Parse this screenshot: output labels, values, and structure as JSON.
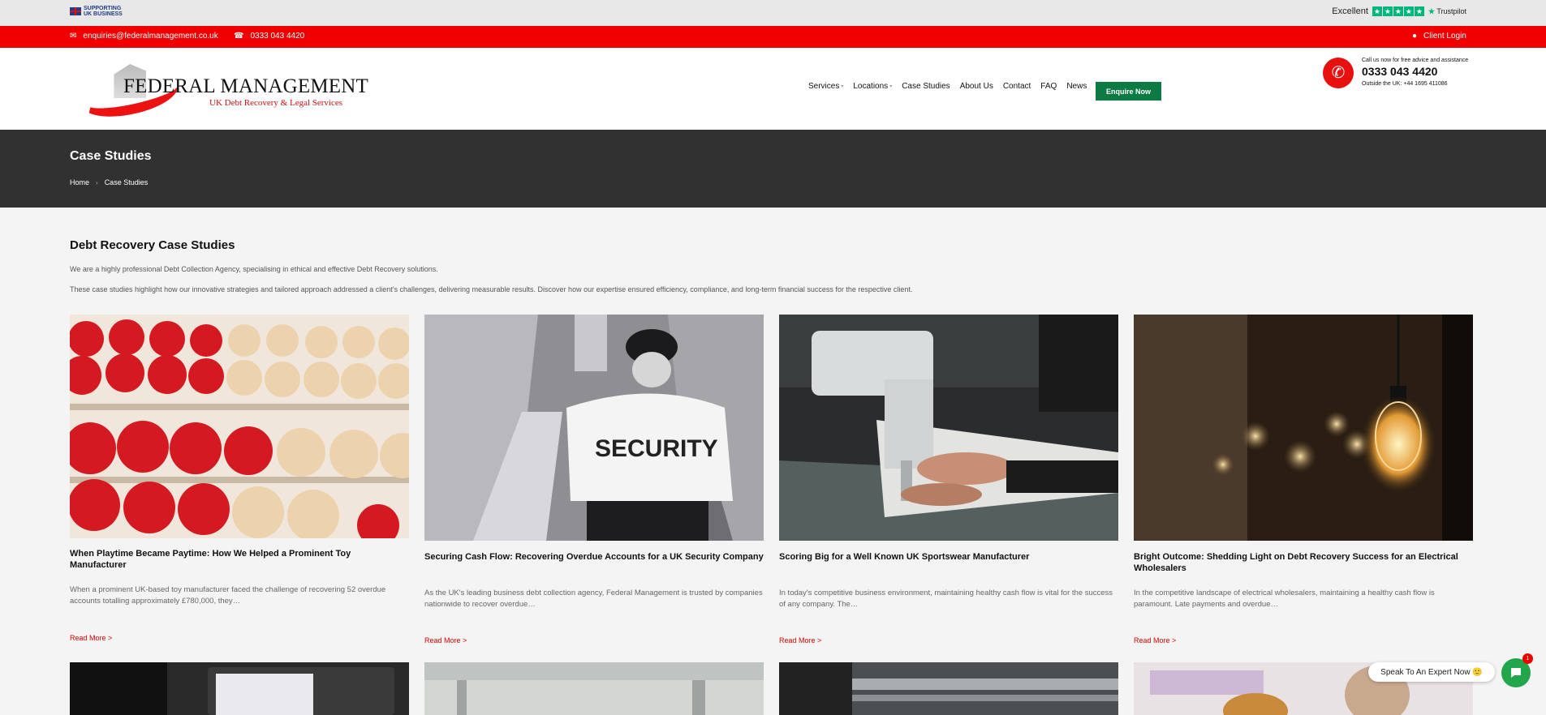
{
  "topbar": {
    "badge_line1": "SUPPORTING",
    "badge_line2": "UK BUSINESS",
    "trustpilot_rating": "Excellent",
    "trustpilot_brand": "Trustpilot",
    "stars": 5
  },
  "contact_bar": {
    "email": "enquiries@federalmanagement.co.uk",
    "phone": "0333 043 4420",
    "client_login": "Client Login"
  },
  "logo": {
    "name": "FEDERAL MANAGEMENT",
    "tagline": "UK Debt Recovery & Legal Services"
  },
  "nav": {
    "items": [
      {
        "label": "Services",
        "dropdown": true
      },
      {
        "label": "Locations",
        "dropdown": true
      },
      {
        "label": "Case Studies",
        "dropdown": false
      },
      {
        "label": "About Us",
        "dropdown": false
      },
      {
        "label": "Contact",
        "dropdown": false
      },
      {
        "label": "FAQ",
        "dropdown": false
      },
      {
        "label": "News",
        "dropdown": false
      }
    ],
    "cta": "Enquire Now"
  },
  "call": {
    "small": "Call us now for free advice and assistance",
    "number": "0333 043 4420",
    "outside": "Outside the UK: +44 1695 411086"
  },
  "page": {
    "title": "Case Studies",
    "breadcrumb": [
      "Home",
      "Case Studies"
    ]
  },
  "intro": {
    "heading": "Debt Recovery Case Studies",
    "p1": "We are a highly professional Debt Collection Agency, specialising in ethical and effective Debt Recovery solutions.",
    "p2": "These case studies highlight how our innovative strategies and tailored approach addressed a client's challenges, delivering measurable results. Discover how our expertise ensured efficiency, compliance, and long-term financial success for the respective client."
  },
  "cards": [
    {
      "title": "When Playtime Became Paytime: How We Helped a Prominent Toy Manufacturer",
      "excerpt": "When a prominent UK-based toy manufacturer faced the challenge of recovering 52 overdue accounts totalling approximately £780,000, they…",
      "read_more": "Read More >",
      "image": "abacus-photo"
    },
    {
      "title": "Securing Cash Flow: Recovering Overdue Accounts for a UK Security Company",
      "excerpt": "As the UK's leading business debt collection agency, Federal Management is trusted by companies nationwide to recover overdue…",
      "read_more": "Read More >",
      "image": "security-guard-photo"
    },
    {
      "title": "Scoring Big for a Well Known UK Sportswear Manufacturer",
      "excerpt": "In today's competitive business environment, maintaining healthy cash flow is vital for the success of any company. The…",
      "read_more": "Read More >",
      "image": "sewing-machine-photo"
    },
    {
      "title": "Bright Outcome: Shedding Light on Debt Recovery Success for an Electrical Wholesalers",
      "excerpt": "In the competitive landscape of electrical wholesalers, maintaining a healthy cash flow is paramount. Late payments and overdue…",
      "read_more": "Read More >",
      "image": "light-bulb-photo"
    }
  ],
  "chat": {
    "bubble": "Speak To An Expert Now 🙂",
    "badge": "1"
  },
  "colors": {
    "red": "#f00000",
    "green": "#0c7a43",
    "dark_band": "#313131",
    "trustpilot_green": "#00b67a"
  }
}
